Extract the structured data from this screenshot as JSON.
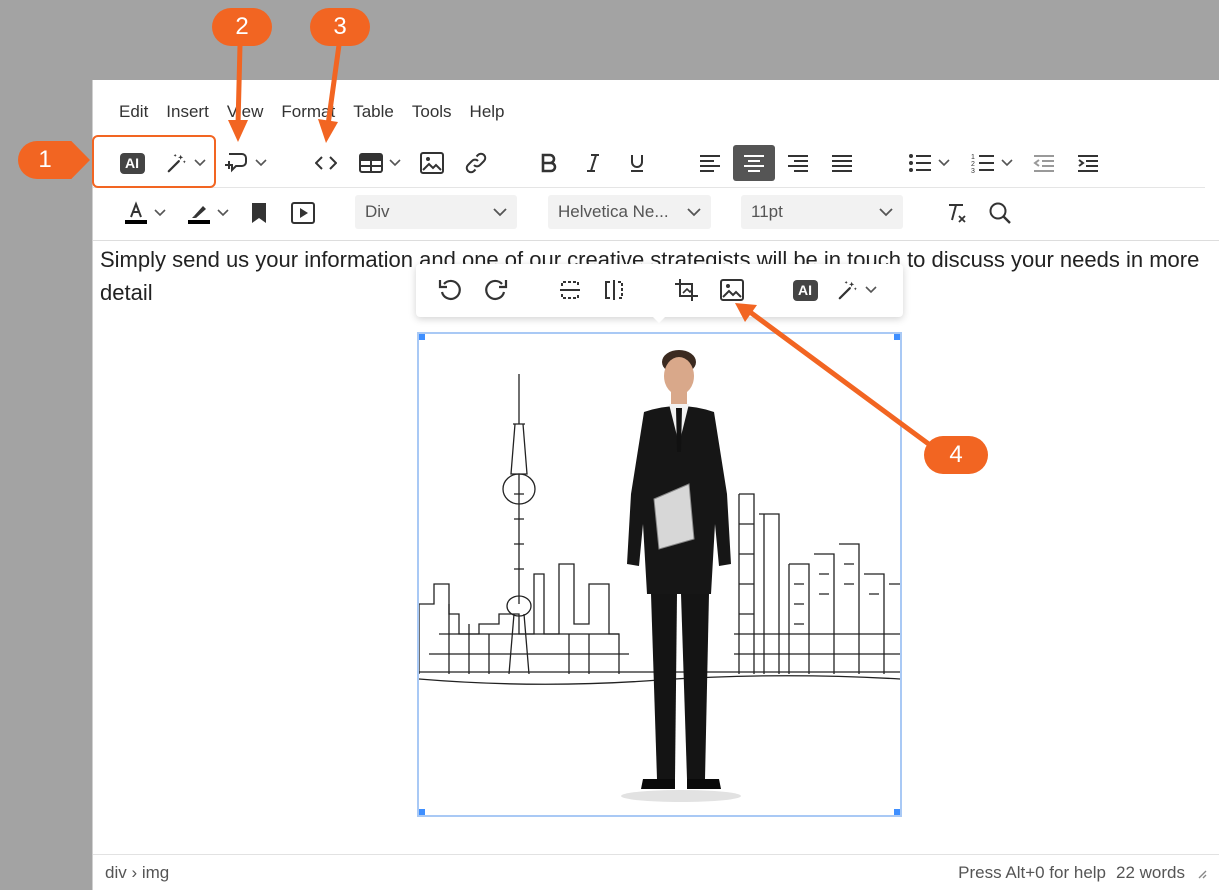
{
  "menubar": {
    "items": [
      "Edit",
      "Insert",
      "View",
      "Format",
      "Table",
      "Tools",
      "Help"
    ]
  },
  "toolbar1": {
    "ai_label": "AI",
    "icons": [
      "ai-icon",
      "magic-wand-icon",
      "comment-add-icon",
      "code-icon",
      "table-icon",
      "image-icon",
      "link-icon",
      "bold-icon",
      "italic-icon",
      "underline-icon",
      "align-left-icon",
      "align-center-icon",
      "align-right-icon",
      "justify-icon",
      "bullet-list-icon",
      "numbered-list-icon",
      "outdent-icon",
      "indent-icon"
    ],
    "active": "align-center-icon"
  },
  "toolbar2": {
    "block_format": "Div",
    "font_family": "Helvetica Ne...",
    "font_size": "11pt",
    "icons": [
      "text-color-icon",
      "highlight-color-icon",
      "bookmark-icon",
      "media-icon",
      "clear-format-icon",
      "search-icon"
    ]
  },
  "content": {
    "paragraph": "Simply send us your information and one of our creative strategists will be in touch to discuss your needs in more detail"
  },
  "image_toolbar": {
    "ai_label": "AI",
    "icons": [
      "rotate-left-icon",
      "rotate-right-icon",
      "flip-vertical-icon",
      "flip-horizontal-icon",
      "crop-icon",
      "image-options-icon",
      "ai-icon",
      "magic-wand-icon"
    ]
  },
  "statusbar": {
    "path": "div › img",
    "help": "Press Alt+0 for help",
    "word_count": "22 words"
  },
  "callouts": [
    "1",
    "2",
    "3",
    "4"
  ],
  "colors": {
    "accent": "#f26522",
    "selection": "#a9c9f5",
    "handle": "#3f8fff"
  }
}
